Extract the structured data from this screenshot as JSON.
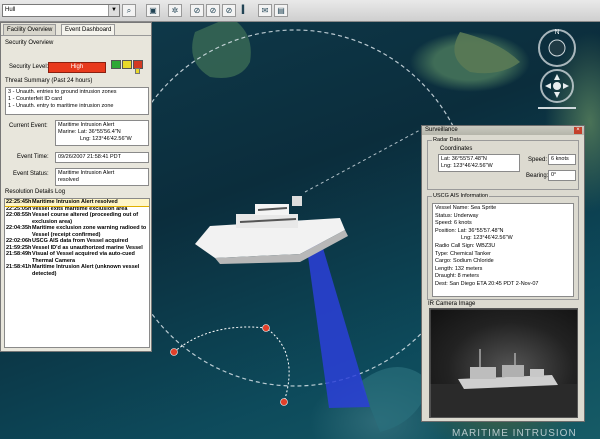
{
  "toolbar": {
    "search_value": "Hull",
    "buttons": [
      "search-icon",
      "globe-icon",
      "settings-icon",
      "link-icon",
      "satellite-icon",
      "ruler-icon",
      "mail-icon",
      "layers-icon"
    ]
  },
  "left_panel": {
    "tabs": [
      "Facility Overview",
      "Event Dashboard"
    ],
    "section_title": "Security Overview",
    "security_level_label": "Security Level:",
    "security_level_value": "High",
    "threat_summary_title": "Threat Summary (Past 24 hours)",
    "threat_summary": [
      "3 - Unauth. entries to ground intrusion zones",
      "1 - Counterfeit ID card",
      "1 - Unauth. entry to maritime intrusion zone"
    ],
    "current_event_label": "Current Event:",
    "current_event": [
      "Maritime Intrusion Alert",
      "Marine: Lat: 36°55'56.4\"N",
      "Lng: 123°46'42.56\"W"
    ],
    "event_time_label": "Event Time:",
    "event_time": "09/26/2007 21:58:41 PDT",
    "event_status_label": "Event Status:",
    "event_status": [
      "Maritime Intrusion Alert",
      "resolved"
    ],
    "resolution_title": "Resolution Details Log",
    "log": [
      {
        "time": "22:25:45h",
        "desc": "Maritime Intrusion Alert resolved"
      },
      {
        "time": "22:25:05h",
        "desc": "Vessel exits maritime exclusion area"
      },
      {
        "time": "22:08:55h",
        "desc": "Vessel course altered (proceeding out of exclusion area)"
      },
      {
        "time": "22:04:35h",
        "desc": "Maritime exclusion zone warning radioed to Vessel (receipt confirmed)"
      },
      {
        "time": "22:02:06h",
        "desc": "USCG AIS data from Vessel acquired"
      },
      {
        "time": "21:59:25h",
        "desc": "Vessel ID'd as unauthorized marine Vessel"
      },
      {
        "time": "21:58:49h",
        "desc": "Visual of Vessel acquired via auto-cued Thermal Camera"
      },
      {
        "time": "21:58:41h",
        "desc": "Maritime Intrusion Alert (unknown vessel detected)"
      }
    ]
  },
  "surveillance": {
    "title": "Surveillance",
    "radar_title": "Radar Data",
    "coords_title": "Coordinates",
    "lat": "Lat: 36°55'57.48\"N",
    "lng": "Lng: 123°46'42.56\"W",
    "speed_label": "Speed:",
    "speed": "6 knots",
    "bearing_label": "Bearing:",
    "bearing": "0°",
    "ais_title": "USCG AIS Information",
    "ais": [
      "Vessel Name: Sea Sprite",
      "Status: Underway",
      "Speed: 6 knots",
      "Position: Lat: 36°55'57.48\"N",
      "Lng: 123°46'42.56\"W",
      "Radio Call Sign: WBZ3U",
      "Type: Chemical Tanker",
      "Cargo: Sodium Chloride",
      "Length: 132 meters",
      "Draught: 8 meters",
      "Dest: San Diego ETA 20:45 PDT 2-Nov-07"
    ],
    "ir_title": "IR Camera Image"
  },
  "watermark": "MARITIME INTRUSION",
  "colors": {
    "high": "#e83a1d",
    "green": "#2fa836",
    "yellow": "#e8d82a",
    "red": "#d23a23",
    "cone": "#2b3fd8"
  }
}
